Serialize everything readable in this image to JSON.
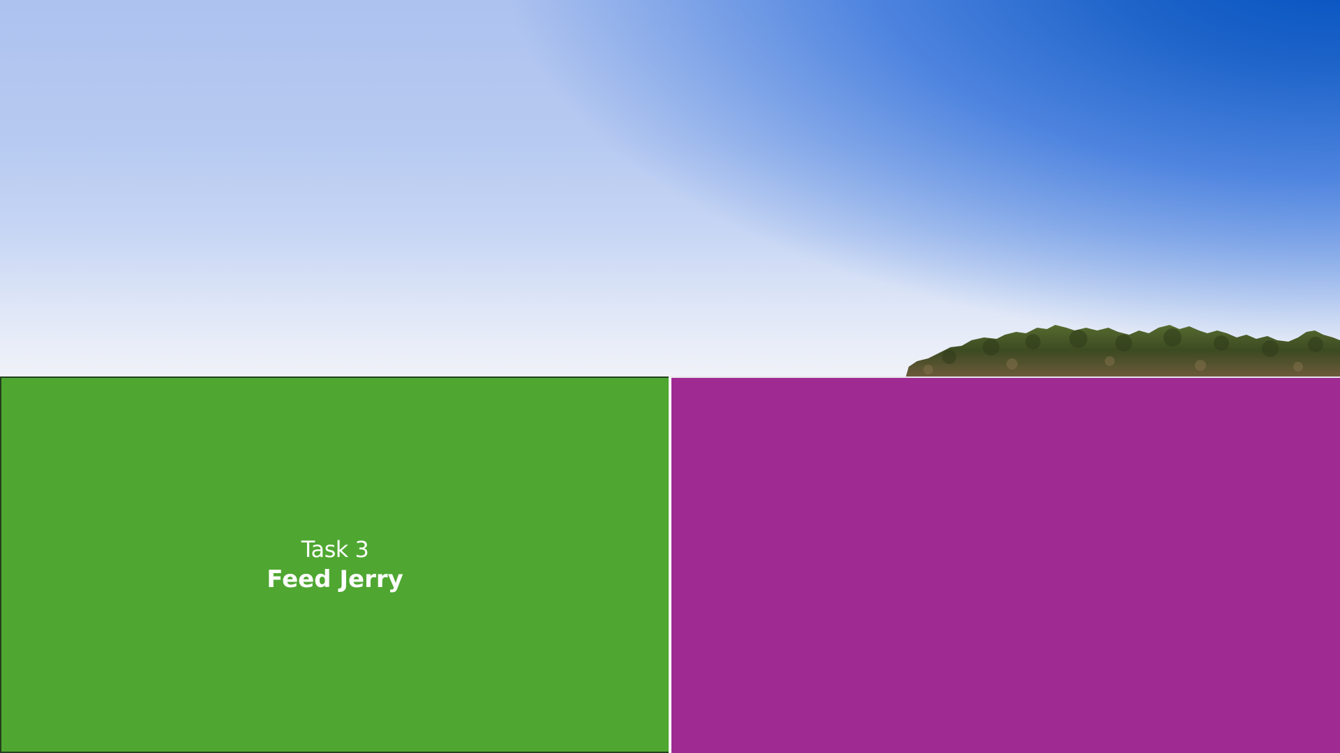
{
  "task": {
    "number_label": "Task 3",
    "name": "Feed Jerry"
  },
  "colors": {
    "left_panel": "#4fa731",
    "right_panel": "#9f2b92",
    "sky_top_right": "#0050bf",
    "sky_left": "#adc2ef",
    "foliage": "#3f4a24"
  }
}
